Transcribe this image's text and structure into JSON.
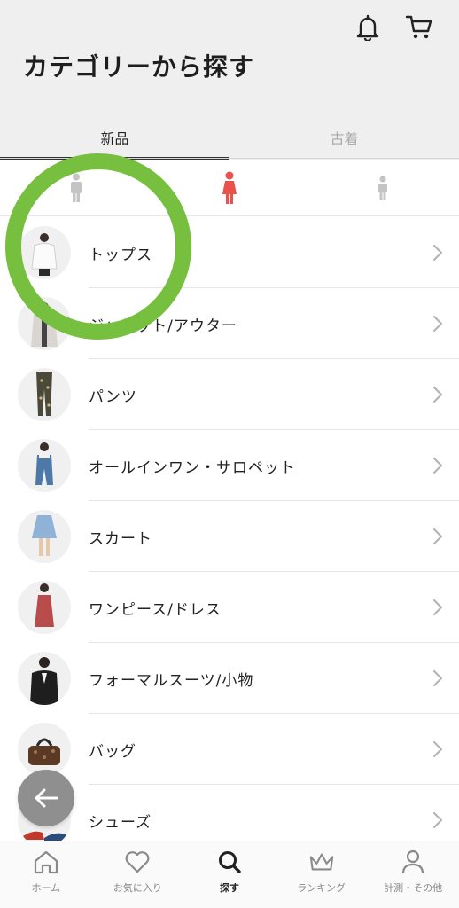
{
  "header": {
    "title": "カテゴリーから探す"
  },
  "tabs": [
    {
      "label": "新品",
      "active": true
    },
    {
      "label": "古着",
      "active": false
    }
  ],
  "gender_filters": [
    {
      "icon": "man-icon",
      "active": false
    },
    {
      "icon": "woman-icon",
      "active": true
    },
    {
      "icon": "kid-icon",
      "active": false
    }
  ],
  "categories": [
    {
      "label": "トップス",
      "thumb": "tops-thumbnail"
    },
    {
      "label": "ジャケット/アウター",
      "thumb": "jacket-thumbnail"
    },
    {
      "label": "パンツ",
      "thumb": "pants-thumbnail"
    },
    {
      "label": "オールインワン・サロペット",
      "thumb": "allinone-thumbnail"
    },
    {
      "label": "スカート",
      "thumb": "skirt-thumbnail"
    },
    {
      "label": "ワンピース/ドレス",
      "thumb": "dress-thumbnail"
    },
    {
      "label": "フォーマルスーツ/小物",
      "thumb": "formal-thumbnail"
    },
    {
      "label": "バッグ",
      "thumb": "bag-thumbnail"
    },
    {
      "label": "シューズ",
      "thumb": "shoes-thumbnail"
    }
  ],
  "bottom_nav": [
    {
      "label": "ホーム",
      "icon": "home-icon",
      "active": false
    },
    {
      "label": "お気に入り",
      "icon": "heart-icon",
      "active": false
    },
    {
      "label": "探す",
      "icon": "search-icon",
      "active": true
    },
    {
      "label": "ランキング",
      "icon": "crown-icon",
      "active": false
    },
    {
      "label": "計測・その他",
      "icon": "person-icon",
      "active": false
    }
  ],
  "colors": {
    "accent": "#e8524a",
    "highlight_ring": "#77bf3f",
    "header_bg": "#efefef"
  }
}
